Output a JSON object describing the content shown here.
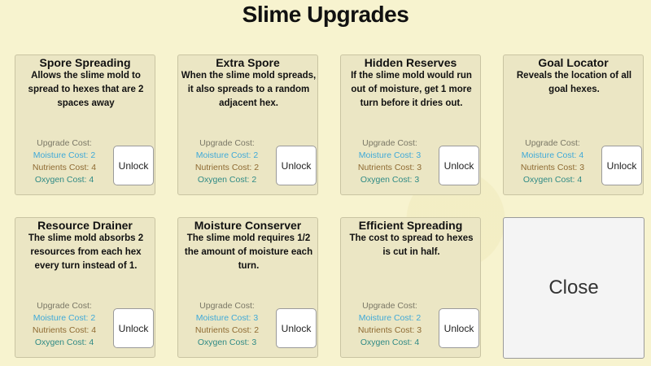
{
  "title": "Slime Upgrades",
  "cost_header": "Upgrade Cost:",
  "unlock_label": "Unlock",
  "close_label": "Close",
  "colors": {
    "background": "#f7f3cf",
    "card": "#ebe6c4",
    "moisture": "#3fa9d8",
    "nutrients": "#8e6a32",
    "oxygen": "#2f8a85"
  },
  "upgrades": [
    {
      "name": "Spore Spreading",
      "desc": [
        "Allows the slime mold to",
        "spread to hexes that are 2",
        "spaces away"
      ],
      "moisture": "Moisture Cost: 2",
      "nutrients": "Nutrients Cost: 4",
      "oxygen": "Oxygen Cost: 4"
    },
    {
      "name": "Extra Spore",
      "desc": [
        "When the slime mold spreads,",
        "it also spreads to a random",
        "adjacent hex."
      ],
      "moisture": "Moisture Cost: 2",
      "nutrients": "Nutrients Cost: 2",
      "oxygen": "Oxygen Cost: 2"
    },
    {
      "name": "Hidden Reserves",
      "desc": [
        "If the slime mold would run",
        "out of moisture, get 1 more",
        "turn before it dries out."
      ],
      "moisture": "Moisture Cost: 3",
      "nutrients": "Nutrients Cost: 3",
      "oxygen": "Oxygen Cost: 3"
    },
    {
      "name": "Goal Locator",
      "desc": [
        "Reveals the location of all",
        "goal hexes."
      ],
      "moisture": "Moisture Cost: 4",
      "nutrients": "Nutrients Cost: 3",
      "oxygen": "Oxygen Cost: 4"
    },
    {
      "name": "Resource Drainer",
      "desc": [
        "The slime mold absorbs 2",
        "resources from each hex",
        "every turn instead of 1."
      ],
      "moisture": "Moisture Cost: 2",
      "nutrients": "Nutrients Cost: 4",
      "oxygen": "Oxygen Cost: 4"
    },
    {
      "name": "Moisture Conserver",
      "desc": [
        "The slime mold requires 1/2",
        "the amount of moisture each",
        "turn."
      ],
      "moisture": "Moisture Cost: 3",
      "nutrients": "Nutrients Cost: 2",
      "oxygen": "Oxygen Cost: 3"
    },
    {
      "name": "Efficient Spreading",
      "desc": [
        "The cost to spread to hexes",
        "is cut in half."
      ],
      "moisture": "Moisture Cost: 2",
      "nutrients": "Nutrients Cost: 3",
      "oxygen": "Oxygen Cost: 4"
    }
  ]
}
